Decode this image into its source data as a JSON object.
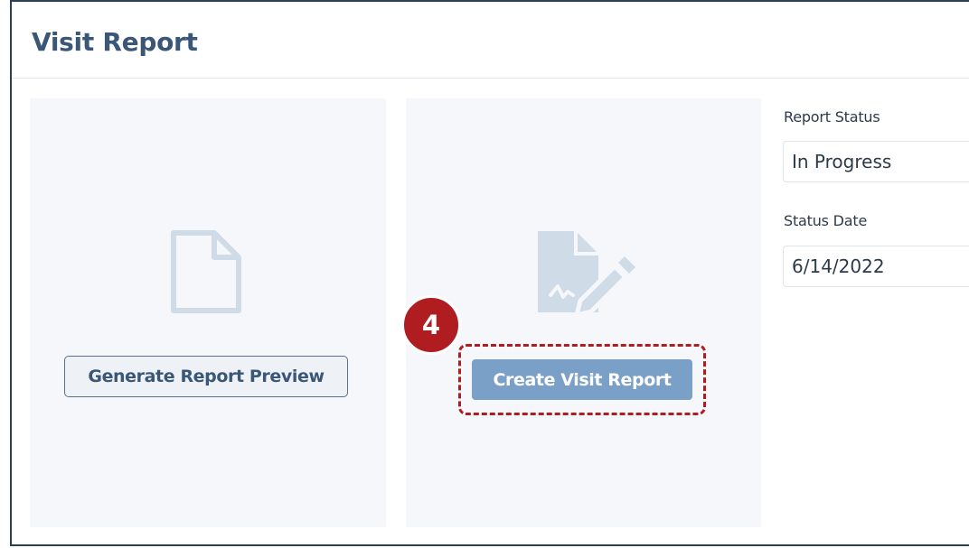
{
  "panel": {
    "title": "Visit Report"
  },
  "preview_card": {
    "icon": "document-icon",
    "button_label": "Generate Report Preview"
  },
  "create_card": {
    "icon": "signed-document-icon",
    "button_label": "Create Visit Report",
    "step_badge": "4"
  },
  "fields": {
    "report_status": {
      "label": "Report Status",
      "value": "In Progress"
    },
    "status_date": {
      "label": "Status Date",
      "value": "6/14/2022"
    }
  },
  "colors": {
    "title": "#3b5778",
    "card_bg": "#f5f7fa",
    "icon": "#cfdbe7",
    "primary_button": "#7aa0c7",
    "highlight": "#b01d21"
  }
}
